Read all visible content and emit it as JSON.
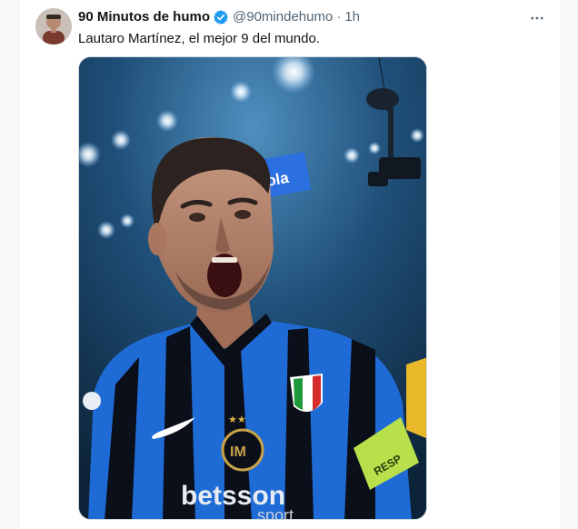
{
  "tweet": {
    "display_name": "90 Minutos de humo",
    "handle": "@90mindehumo",
    "separator": "·",
    "time": "1h",
    "text": "Lautaro Martínez, el mejor 9 del mundo.",
    "more_icon": "more-horizontal-icon",
    "verified_icon": "verified-badge-icon"
  },
  "media": {
    "sponsor_text": "betsson",
    "sponsor_sub": "sport",
    "banner_text": "cola",
    "armband_text": "RESP",
    "description_alt": "photo"
  },
  "colors": {
    "verified_blue": "#1d9bf0",
    "text_primary": "#0f1419",
    "text_secondary": "#536471",
    "jersey_blue": "#1f6bd6",
    "jersey_black": "#0b0f1a",
    "armband_green": "#b8e04a"
  }
}
